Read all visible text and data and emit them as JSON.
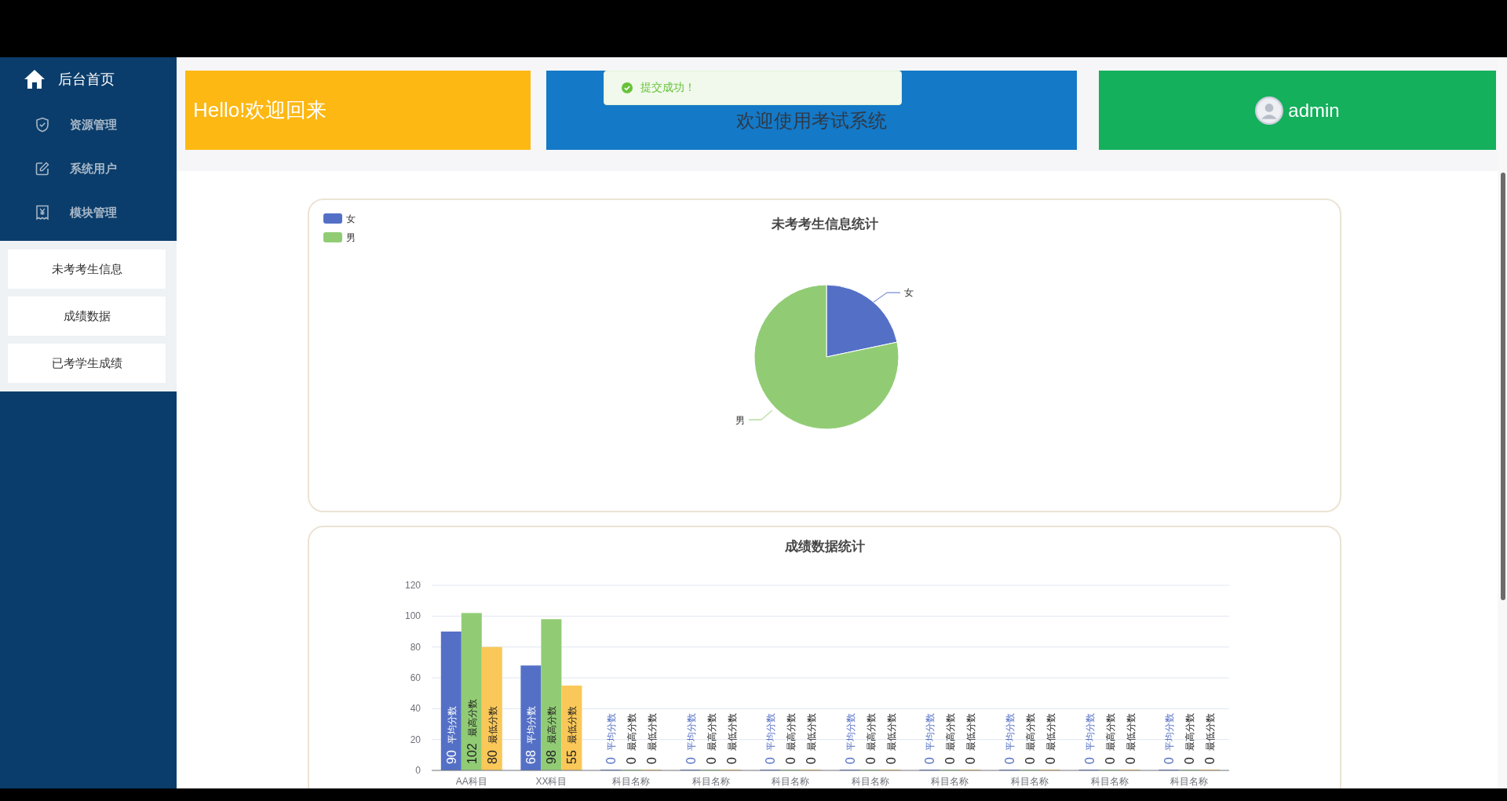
{
  "sidebar": {
    "home": {
      "label": "后台首页"
    },
    "menu": [
      {
        "label": "资源管理"
      },
      {
        "label": "系统用户"
      },
      {
        "label": "模块管理"
      }
    ],
    "submenu": [
      {
        "label": "未考考生信息"
      },
      {
        "label": "成绩数据"
      },
      {
        "label": "已考学生成绩"
      }
    ]
  },
  "header_cards": {
    "greeting": "Hello!欢迎回来",
    "welcome": "欢迎使用考试系统",
    "user": "admin"
  },
  "toast": {
    "message": "提交成功！"
  },
  "pie_panel": {
    "title": "未考考生信息统计",
    "legend": [
      {
        "label": "女",
        "color": "#5470c6"
      },
      {
        "label": "男",
        "color": "#91cc75"
      }
    ],
    "slice_labels": [
      "女",
      "男"
    ]
  },
  "bar_panel": {
    "title": "成绩数据统计",
    "chart_data": {
      "type": "bar",
      "categories": [
        "AA科目",
        "XX科目",
        "科目名称",
        "科目名称",
        "科目名称",
        "科目名称",
        "科目名称",
        "科目名称",
        "科目名称",
        "科目名称"
      ],
      "series": [
        {
          "name": "平均分数",
          "color": "#5470c6",
          "values": [
            90,
            68,
            0,
            0,
            0,
            0,
            0,
            0,
            0,
            0
          ]
        },
        {
          "name": "最高分数",
          "color": "#91cc75",
          "values": [
            102,
            98,
            0,
            0,
            0,
            0,
            0,
            0,
            0,
            0
          ]
        },
        {
          "name": "最低分数",
          "color": "#fac858",
          "values": [
            80,
            55,
            0,
            0,
            0,
            0,
            0,
            0,
            0,
            0
          ]
        }
      ],
      "ylim": [
        0,
        120
      ],
      "grid": true,
      "yticks": [
        0,
        20,
        40,
        60,
        80,
        100,
        120
      ],
      "data_labels": true
    }
  }
}
